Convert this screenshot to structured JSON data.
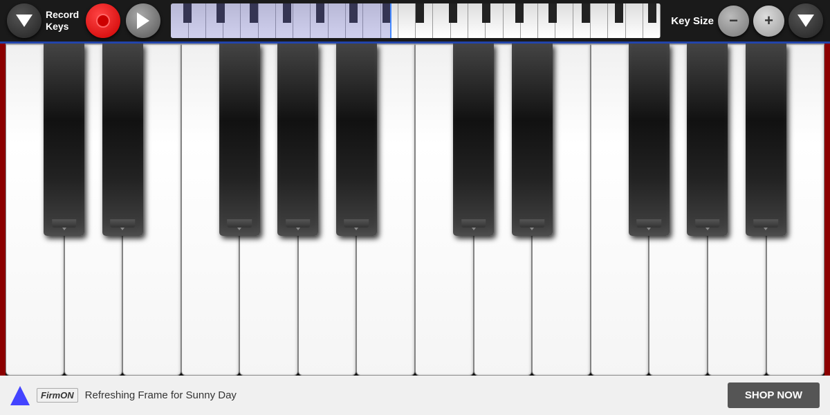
{
  "header": {
    "record_keys_label": "Record\nKeys",
    "key_size_label": "Key Size",
    "btn_record_label": "",
    "btn_play_label": "",
    "btn_size_minus_label": "−",
    "btn_size_plus_label": "+"
  },
  "ad": {
    "text": "Refreshing Frame for Sunny Day",
    "shop_now": "SHOP NOW",
    "logo": "FirmON"
  },
  "piano": {
    "white_key_count": 14,
    "octaves": 2
  }
}
